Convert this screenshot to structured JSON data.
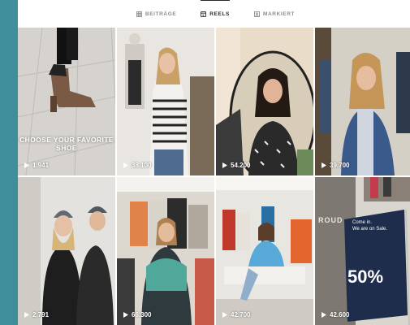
{
  "tabs": [
    {
      "label": "BEITRÄGE",
      "icon": "grid-icon",
      "active": false
    },
    {
      "label": "REELS",
      "icon": "reels-icon",
      "active": true
    },
    {
      "label": "MARKIERT",
      "icon": "tag-icon",
      "active": false
    }
  ],
  "reels": [
    {
      "views": "1.941",
      "caption": "CHOOSE YOUR FAVORITE SHOE"
    },
    {
      "views": "38.100"
    },
    {
      "views": "54.200"
    },
    {
      "views": "39.700"
    },
    {
      "views": "2.791"
    },
    {
      "views": "66.300"
    },
    {
      "views": "42.700"
    },
    {
      "views": "42.600",
      "store_word": "ROUD",
      "sale_line1": "Come in.",
      "sale_line2": "We are on Sale.",
      "sale_percent": "50%"
    }
  ],
  "colors": {
    "background": "#3f8e9c",
    "active_tab": "#262626",
    "inactive_tab": "#8e8e8e"
  }
}
